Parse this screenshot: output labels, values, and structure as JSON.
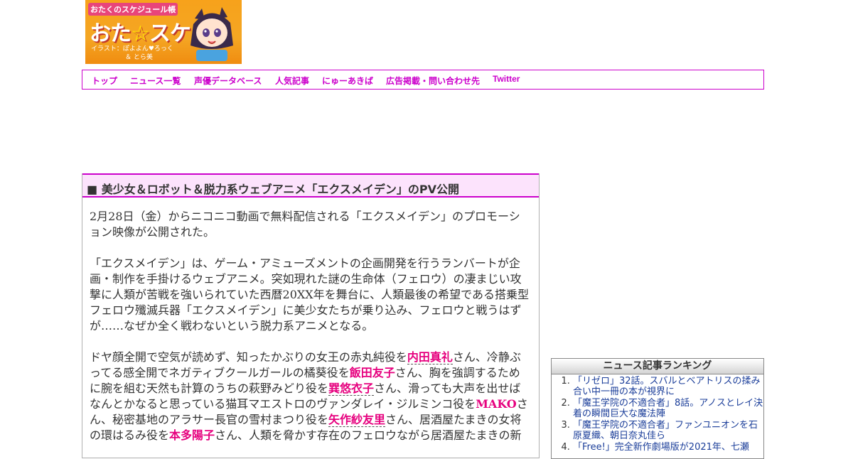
{
  "logo": {
    "tagline": "おたくのスケジュール帳",
    "title_part1": "おた",
    "title_star": "☆",
    "title_part2": "スケ",
    "credit_line1": "イラスト：ぽよよん♥ろっく",
    "credit_line2": "＆ とら美"
  },
  "nav": {
    "items": [
      {
        "label": "トップ"
      },
      {
        "label": "ニュース一覧"
      },
      {
        "label": "声優データベース"
      },
      {
        "label": "人気記事"
      },
      {
        "label": "にゅーあきば"
      },
      {
        "label": "広告掲載・問い合わせ先"
      },
      {
        "label": "Twitter"
      }
    ]
  },
  "article": {
    "title": "■ 美少女＆ロボット＆脱力系ウェブアニメ「エクスメイデン」のPV公開",
    "p1": "2月28日（金）からニコニコ動画で無料配信される「エクスメイデン」のプロモーション映像が公開された。",
    "p2": "「エクスメイデン」は、ゲーム・アミューズメントの企画開発を行うランバートが企画・制作を手掛けるウェブアニメ。突如現れた謎の生命体（フェロウ）の凄まじい攻撃に人類が苦戦を強いられていた西暦20XX年を舞台に、人類最後の希望である搭乗型フェロウ殲滅兵器「エクスメイデン」に美少女たちが乗り込み、フェロウと戦うはずが……なぜか全く戦わないという脱力系アニメとなる。",
    "p3": {
      "t1": "ドヤ顔全開で空気が読めず、知ったかぶりの女王の赤丸純役を",
      "a1": "内田真礼",
      "t2": "さん、冷静ぶってる感全開でネガティブクールガールの橘葵役を",
      "a2": "飯田友子",
      "t3": "さん、胸を強調するために腕を組む天然も計算のうちの萩野みどり役を",
      "a3": "巽悠衣子",
      "t4": "さん、滑っても大声を出せばなんとかなると思っている猫耳マエストロのヴァンダレイ・ジルミンコ役を",
      "a4": "MAKO",
      "t5": "さん、秘密基地のアラサー長官の雪村まつり役を",
      "a5": "矢作紗友里",
      "t6": "さん、居酒屋たまきの女将の環はるみ役を",
      "a6": "本多陽子",
      "t7": "さん、人類を脅かす存在のフェロウながら居酒屋たまきの新"
    }
  },
  "ranking": {
    "title": "ニュース記事ランキング",
    "items": [
      {
        "text": "「リゼロ」32話。スバルとベアトリスの揉み合い中一冊の本が視界に"
      },
      {
        "text": "「魔王学院の不適合者」8話。アノスとレイ決着の瞬間巨大な魔法陣"
      },
      {
        "text": "「魔王学院の不適合者」ファンユニオンを石原夏織、朝日奈丸佳ら"
      },
      {
        "text": "「Free!」完全新作劇場版が2021年、七瀬"
      }
    ]
  },
  "colors": {
    "accent": "#cc00cc",
    "header_bg": "#fce3fc",
    "actor": "#e6007e",
    "link": "#1a3d99"
  }
}
